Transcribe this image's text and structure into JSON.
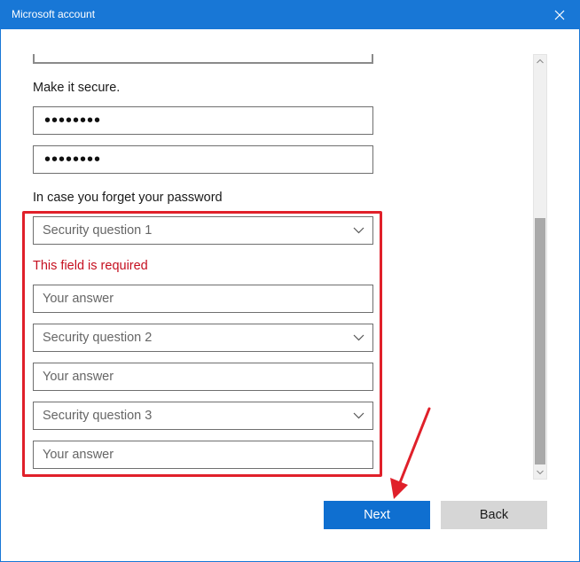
{
  "window": {
    "title": "Microsoft account",
    "close_icon": "close-icon"
  },
  "form": {
    "secure_label": "Make it secure.",
    "password_value": "••••••••",
    "confirm_password_value": "••••••••",
    "recovery_label": "In case you forget your password",
    "security_question_1": "Security question 1",
    "error_text": "This field is required",
    "answer_1_placeholder": "Your answer",
    "security_question_2": "Security question 2",
    "answer_2_placeholder": "Your answer",
    "security_question_3": "Security question 3",
    "answer_3_placeholder": "Your answer"
  },
  "buttons": {
    "next": "Next",
    "back": "Back"
  },
  "colors": {
    "titlebar": "#1877d6",
    "primary_button": "#0f6fd0",
    "error": "#c50f1f",
    "highlight": "#e0202a"
  }
}
